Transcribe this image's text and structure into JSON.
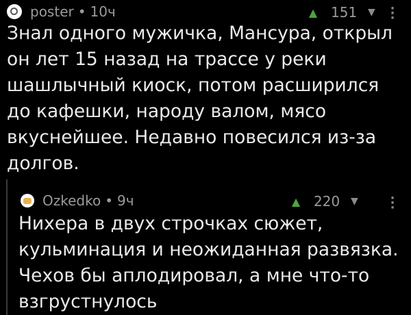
{
  "comments": [
    {
      "author": "poster",
      "time": "10ч",
      "separator": "•",
      "votes": "151",
      "text": "Знал одного мужичка, Мансура, открыл\nон лет 15 назад на трассе у реки\nшашлычный киоск, потом расширился\nдо кафешки, народу валом, мясо\nвкуснейшее. Недавно повесился из-за\nдолгов."
    },
    {
      "author": "Ozkedko",
      "time": "9ч",
      "separator": "•",
      "votes": "220",
      "text": "Нихера в двух строчках сюжет,\nкульминация и неожиданная развязка.\nЧехов бы аплодировал, а мне что-то\nвзгрустнулось"
    }
  ],
  "icons": {
    "upvote": "triangle-up-icon",
    "downvote": "triangle-down-icon",
    "more": "kebab-menu-icon",
    "upvote_color": "#4fa33f"
  }
}
